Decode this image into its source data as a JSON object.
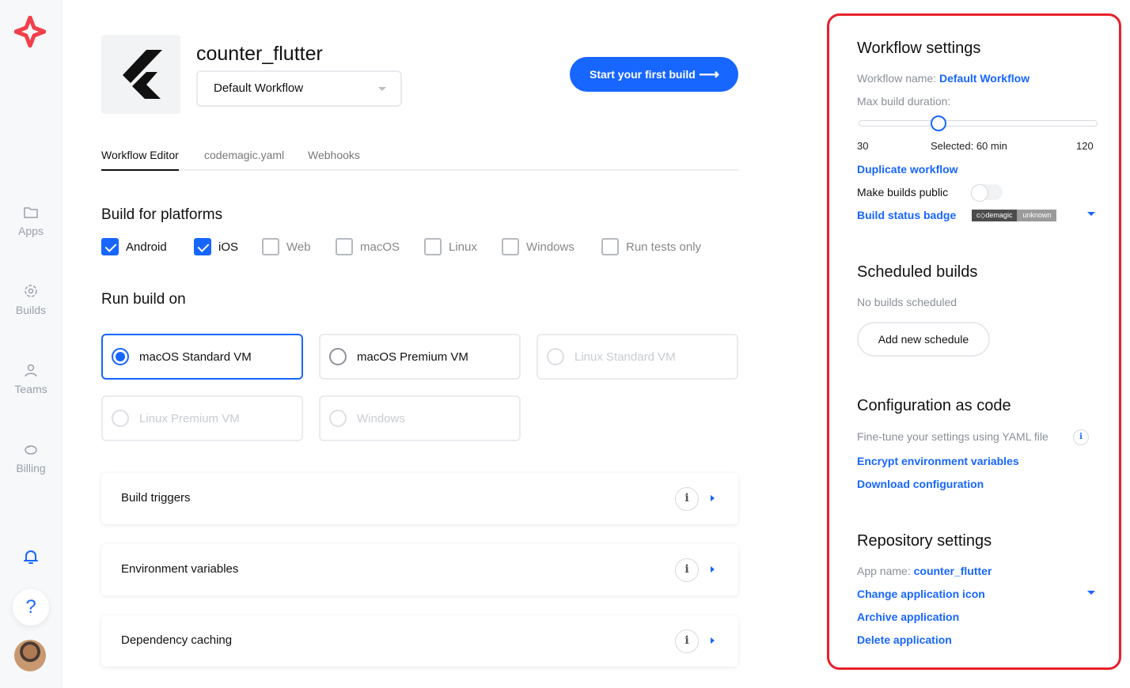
{
  "sidebar": {
    "items": [
      {
        "label": "Apps",
        "icon": "folder-icon"
      },
      {
        "label": "Builds",
        "icon": "builds-icon"
      },
      {
        "label": "Teams",
        "icon": "user-icon"
      },
      {
        "label": "Billing",
        "icon": "piggy-bank-icon"
      }
    ],
    "help_label": "?"
  },
  "header": {
    "app_name": "counter_flutter",
    "workflow_select": "Default Workflow",
    "start_button": "Start your first build",
    "start_arrow": "⟶"
  },
  "tabs": [
    "Workflow Editor",
    "codemagic.yaml",
    "Webhooks"
  ],
  "platforms": {
    "title": "Build for platforms",
    "items": [
      {
        "label": "Android",
        "checked": true
      },
      {
        "label": "iOS",
        "checked": true
      },
      {
        "label": "Web",
        "checked": false
      },
      {
        "label": "macOS",
        "checked": false
      },
      {
        "label": "Linux",
        "checked": false
      },
      {
        "label": "Windows",
        "checked": false
      },
      {
        "label": "Run tests only",
        "checked": false
      }
    ]
  },
  "run_on": {
    "title": "Run build on",
    "options": [
      {
        "label": "macOS Standard VM",
        "state": "selected"
      },
      {
        "label": "macOS Premium VM",
        "state": "available"
      },
      {
        "label": "Linux Standard VM",
        "state": "disabled"
      },
      {
        "label": "Linux Premium VM",
        "state": "disabled"
      },
      {
        "label": "Windows",
        "state": "disabled"
      }
    ]
  },
  "panels": [
    "Build triggers",
    "Environment variables",
    "Dependency caching"
  ],
  "info_glyph": "i",
  "workflow_settings": {
    "title": "Workflow settings",
    "name_label": "Workflow name:",
    "name_value": "Default Workflow",
    "duration_label": "Max build duration:",
    "duration_min": "30",
    "duration_selected": "Selected: 60 min",
    "duration_max": "120",
    "duration_value": 60,
    "duration_range": [
      30,
      120
    ],
    "duplicate": "Duplicate workflow",
    "public_label": "Make builds public",
    "public_enabled": false,
    "badge_label": "Build status badge",
    "badge_left": "c◇demagic",
    "badge_right": "unknown"
  },
  "scheduled": {
    "title": "Scheduled builds",
    "empty": "No builds scheduled",
    "add_button": "Add new schedule"
  },
  "config_code": {
    "title": "Configuration as code",
    "desc": "Fine-tune your settings using YAML file",
    "encrypt": "Encrypt environment variables",
    "download": "Download configuration"
  },
  "repo": {
    "title": "Repository settings",
    "app_label": "App name:",
    "app_value": "counter_flutter",
    "change_icon": "Change application icon",
    "archive": "Archive application",
    "delete": "Delete application"
  },
  "colors": {
    "accent": "#1766ff",
    "highlight_border": "#e8202b"
  }
}
